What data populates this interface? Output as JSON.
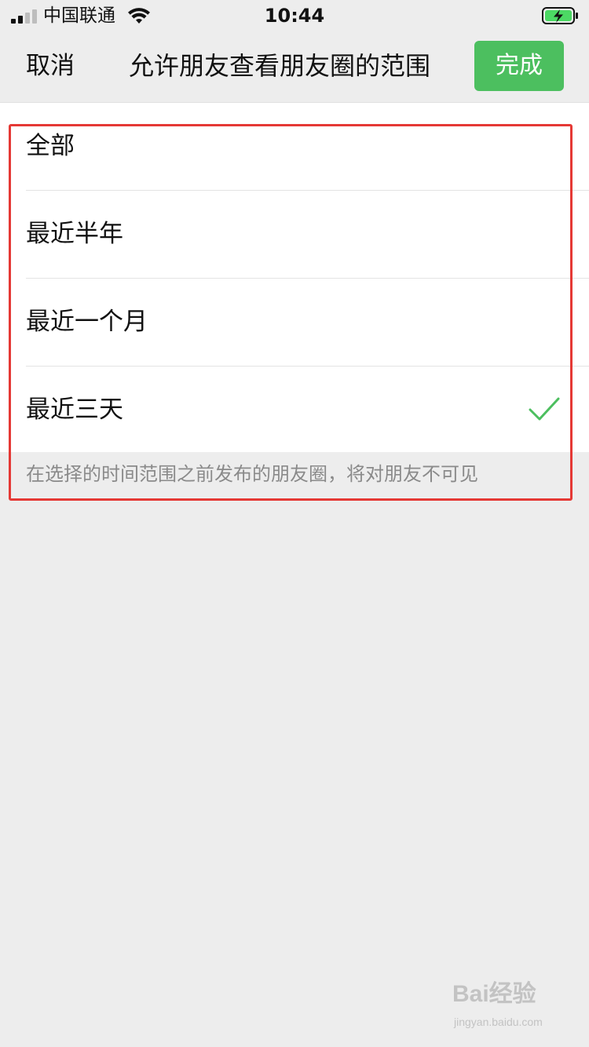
{
  "status_bar": {
    "carrier": "中国联通",
    "time": "10:44",
    "signal_bars": 4,
    "signal_active_bars": 2,
    "battery_level": 0.9,
    "battery_charging": true,
    "battery_color": "#4cd964"
  },
  "nav": {
    "cancel_label": "取消",
    "title": "允许朋友查看朋友圈的范围",
    "done_label": "完成",
    "done_color": "#4cbf5f"
  },
  "options": [
    {
      "label": "全部",
      "selected": false
    },
    {
      "label": "最近半年",
      "selected": false
    },
    {
      "label": "最近一个月",
      "selected": false
    },
    {
      "label": "最近三天",
      "selected": true
    }
  ],
  "check_icon": "checkmark-icon",
  "check_color": "#4cbf5f",
  "hint_text": "在选择的时间范围之前发布的朋友圈，将对朋友不可见",
  "highlight_color": "#e53935",
  "watermark": {
    "main": "Bai经验",
    "sub": "jingyan.baidu.com"
  }
}
